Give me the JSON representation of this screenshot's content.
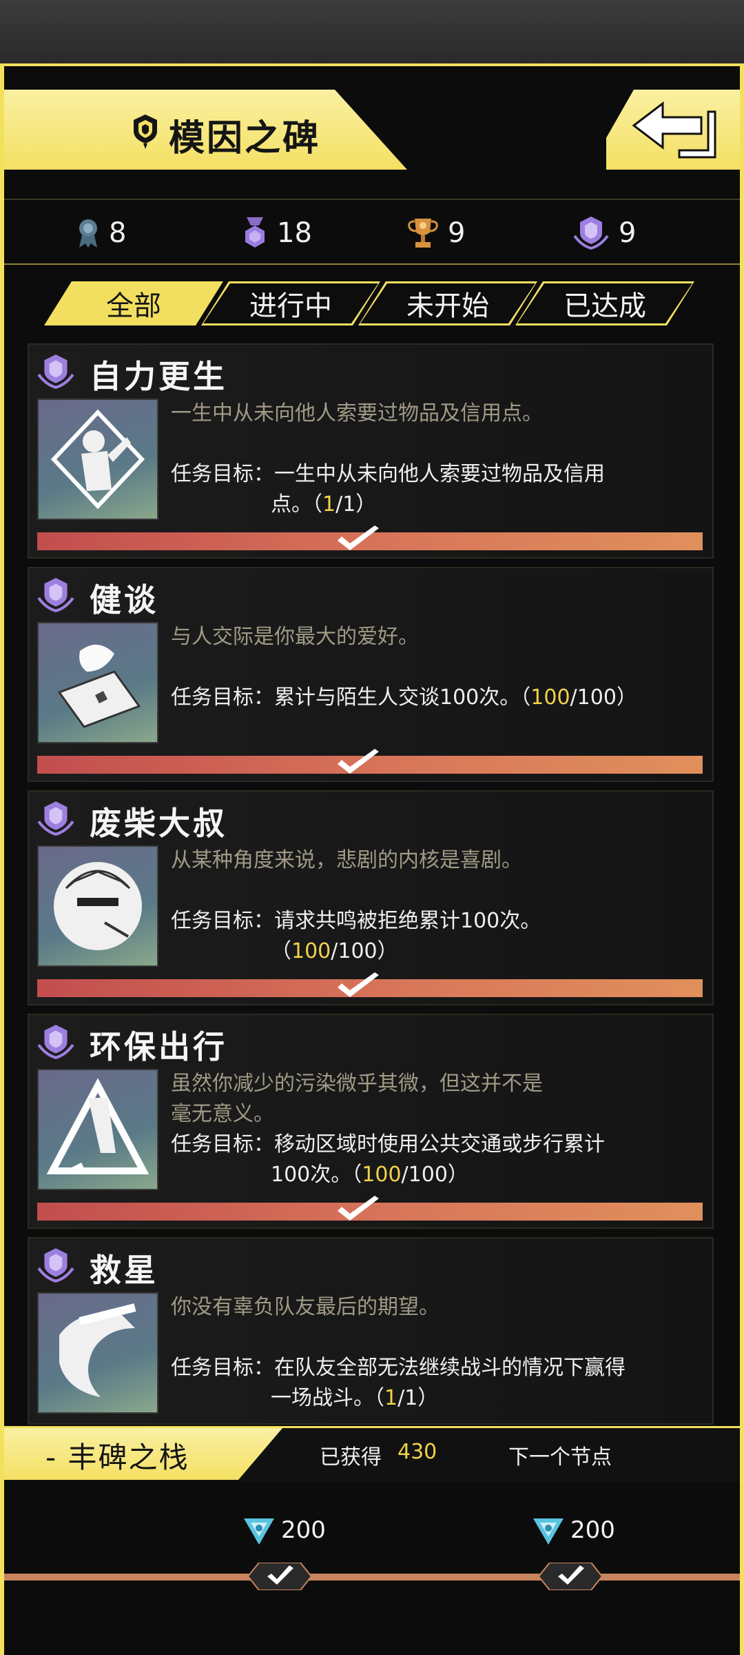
{
  "header": {
    "title": "模因之碑",
    "title_icon": "badge-icon",
    "back_icon": "return-arrow-icon"
  },
  "stats": [
    {
      "icon": "ribbon-medal-icon",
      "value": "8"
    },
    {
      "icon": "hex-medal-icon",
      "value": "18"
    },
    {
      "icon": "trophy-icon",
      "value": "9"
    },
    {
      "icon": "crest-medal-icon",
      "value": "9"
    }
  ],
  "tabs": [
    {
      "label": "全部",
      "active": true
    },
    {
      "label": "进行中",
      "active": false
    },
    {
      "label": "未开始",
      "active": false
    },
    {
      "label": "已达成",
      "active": false
    }
  ],
  "goal_prefix": "任务目标：",
  "achievements": [
    {
      "name": "自力更生",
      "desc": "一生中从未向他人索要过物品及信用点。",
      "goal_line1": "一生中从未向他人索要过物品及信用",
      "goal_line2_pre": "点。（",
      "progress_current": "1",
      "progress_total": "/1）",
      "completed": true
    },
    {
      "name": "健谈",
      "desc": "与人交际是你最大的爱好。",
      "goal_line1": "累计与陌生人交谈100次。（",
      "progress_current": "100",
      "progress_total": "/100）",
      "completed": true
    },
    {
      "name": "废柴大叔",
      "desc": "从某种角度来说，悲剧的内核是喜剧。",
      "goal_line1": "请求共鸣被拒绝累计100次。",
      "goal_line2_pre": "（",
      "progress_current": "100",
      "progress_total": "/100）",
      "completed": true
    },
    {
      "name": "环保出行",
      "desc": "虽然你减少的污染微乎其微，但这并不是毫无意义。",
      "goal_line1": "移动区域时使用公共交通或步行累计",
      "goal_line2_pre": "100次。（",
      "progress_current": "100",
      "progress_total": "/100）",
      "completed": true
    },
    {
      "name": "救星",
      "desc": "你没有辜负队友最后的期望。",
      "goal_line1": "在队友全部无法继续战斗的情况下赢得",
      "goal_line2_pre": "一场战斗。（",
      "progress_current": "1",
      "progress_total": "/1）",
      "completed": true
    }
  ],
  "bottom": {
    "title": "- 丰碑之栈",
    "obtained_label": "已获得",
    "obtained_value": "430",
    "next_node_label": "下一个节点",
    "rewards": [
      {
        "icon": "crystal-currency-icon",
        "amount": "200"
      },
      {
        "icon": "crystal-currency-icon",
        "amount": "200"
      }
    ]
  },
  "colors": {
    "accent_yellow": "#f3df5f",
    "highlight": "#f2d34a",
    "progress_start": "#c24e4e",
    "progress_end": "#e0905c",
    "desc_text": "#a09a86"
  }
}
